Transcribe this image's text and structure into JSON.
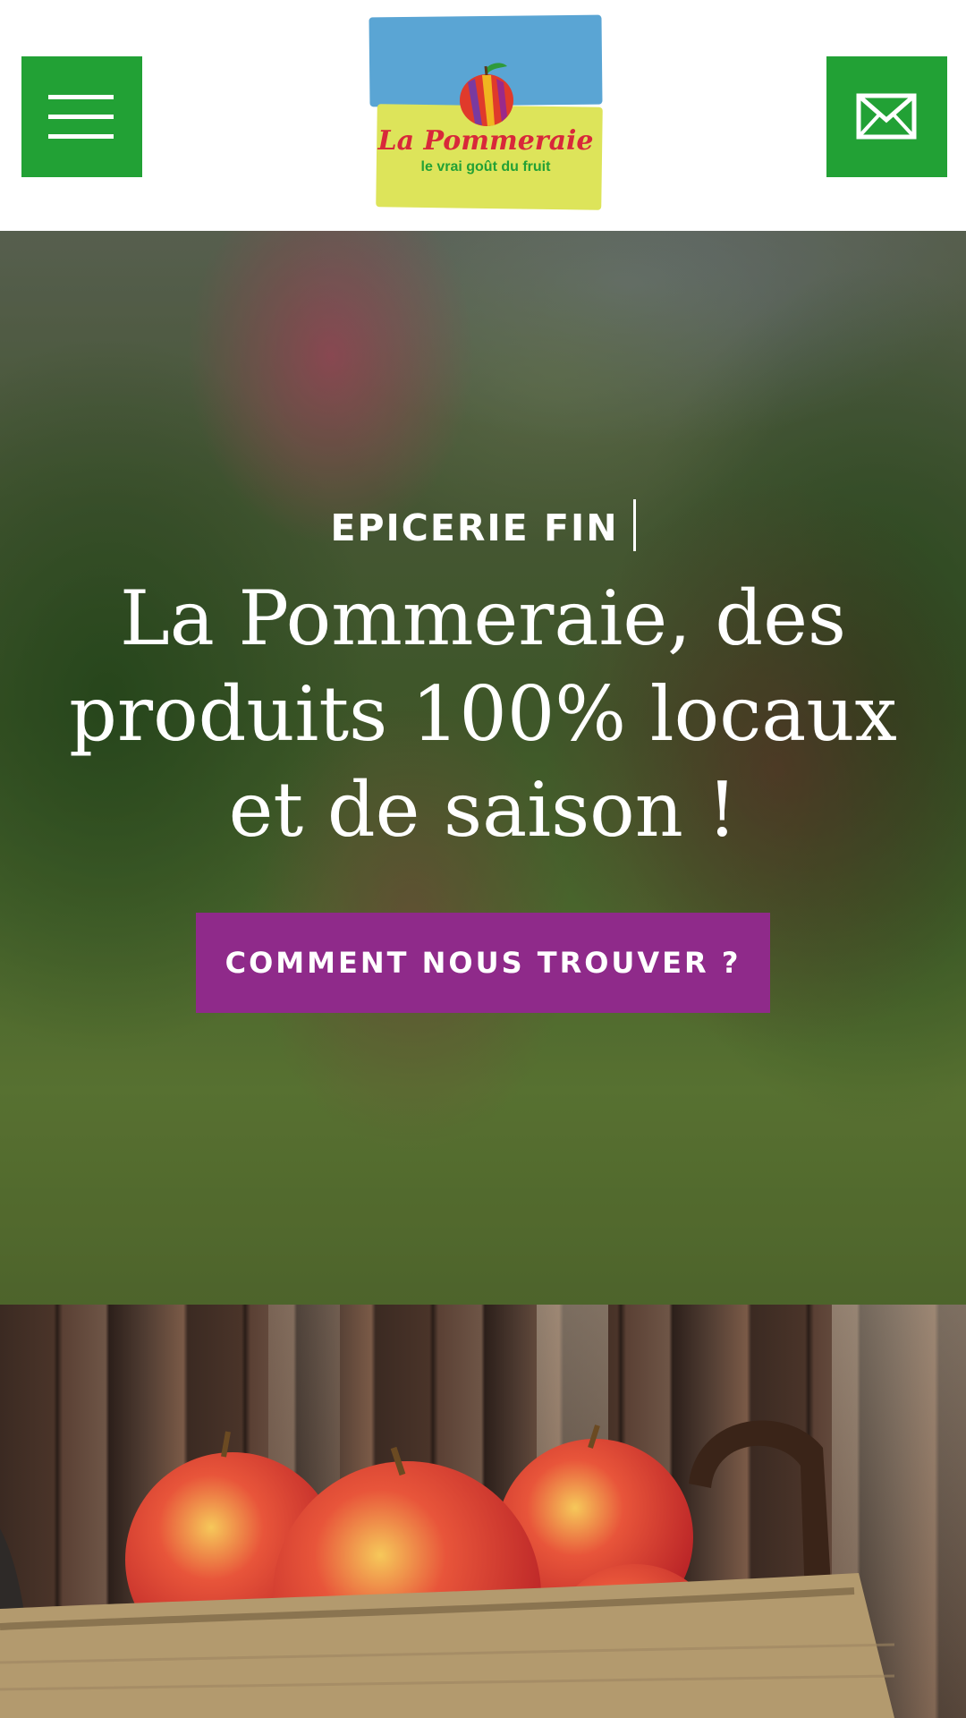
{
  "header": {
    "menu_label": "Menu",
    "contact_label": "Contact",
    "logo": {
      "name": "La Pommeraie",
      "tagline": "le vrai goût du fruit"
    }
  },
  "hero": {
    "kicker": "EPICERIE FIN",
    "title": "La Pommeraie, des produits 100% locaux et de saison !",
    "cta_label": "COMMENT NOUS TROUVER ?"
  },
  "colors": {
    "brand_green": "#22a135",
    "cta_purple": "#8f2a8a",
    "logo_blue": "#5aa5d4",
    "logo_yellow": "#dde45a",
    "logo_red": "#d8283a"
  },
  "icons": {
    "menu": "hamburger-icon",
    "contact": "envelope-icon"
  }
}
